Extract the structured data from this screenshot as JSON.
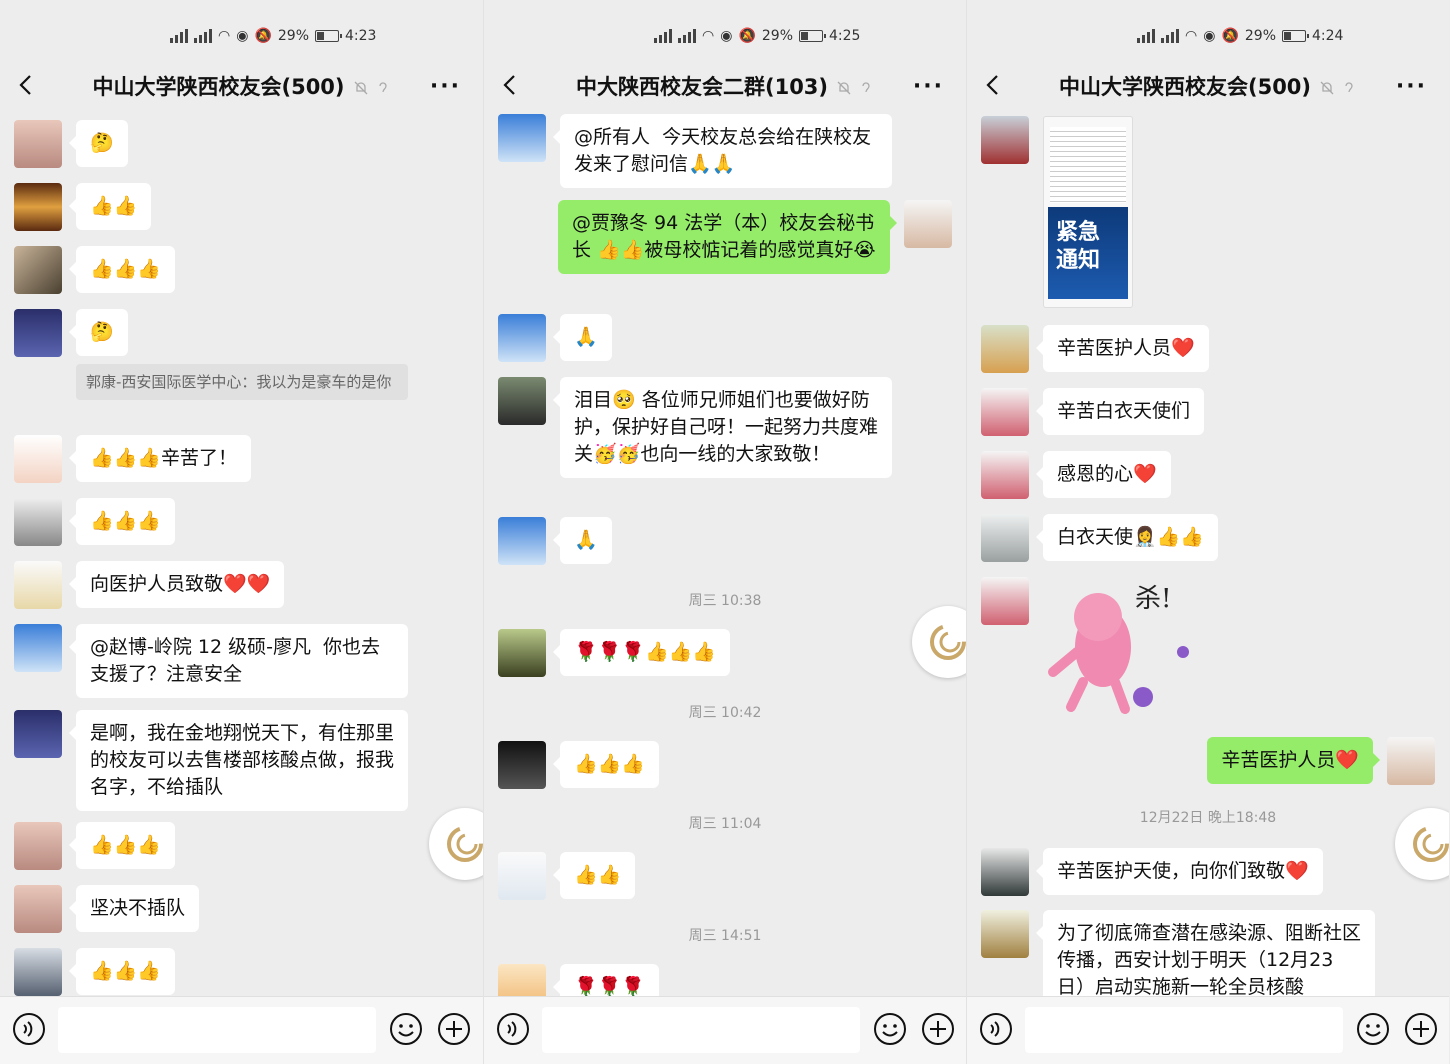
{
  "panels": [
    {
      "status": {
        "battery": "29%",
        "time": "4:23"
      },
      "title": "中山大学陕西校友会(500)",
      "messages": [
        {
          "text": "🤔"
        },
        {
          "text": "👍👍"
        },
        {
          "text": "👍👍👍"
        },
        {
          "text": "🤔"
        },
        {
          "quote": "郭康-西安国际医学中心：我以为是豪车的是你"
        },
        {
          "text": "👍👍👍辛苦了！"
        },
        {
          "text": "👍👍👍"
        },
        {
          "text": "向医护人员致敬❤️❤️"
        },
        {
          "text": "@赵博-岭院 12 级硕-廖凡  你也去支援了？注意安全"
        },
        {
          "text": "是啊，我在金地翔悦天下，有住那里的校友可以去售楼部核酸点做，报我名字，不给插队"
        },
        {
          "text": "👍👍👍"
        },
        {
          "text": "坚决不插队"
        },
        {
          "text": "👍👍👍"
        }
      ]
    },
    {
      "status": {
        "battery": "29%",
        "time": "4:25"
      },
      "title": "中大陕西校友会二群(103)",
      "messages": [
        {
          "text": "@所有人  今天校友总会给在陕校友发来了慰问信🙏🙏"
        },
        {
          "text": "@贾豫冬 94 法学（本）校友会秘书长 👍👍被母校惦记着的感觉真好😭"
        },
        {
          "text": "🙏"
        },
        {
          "text": "泪目🥺 各位师兄师姐们也要做好防护，保护好自己呀！一起努力共度难关🥳🥳也向一线的大家致敬！"
        },
        {
          "text": "🙏"
        },
        {
          "time": "周三 10:38"
        },
        {
          "text": "🌹🌹🌹👍👍👍"
        },
        {
          "time": "周三 10:42"
        },
        {
          "text": "👍👍👍"
        },
        {
          "time": "周三 11:04"
        },
        {
          "text": "👍👍"
        },
        {
          "time": "周三 14:51"
        },
        {
          "text": "🌹🌹🌹"
        }
      ]
    },
    {
      "status": {
        "battery": "29%",
        "time": "4:24"
      },
      "title": "中山大学陕西校友会(500)",
      "messages": [
        {
          "image_text": "紧急\n通知"
        },
        {
          "text": "辛苦医护人员❤️"
        },
        {
          "text": "辛苦白衣天使们"
        },
        {
          "text": "感恩的心❤️"
        },
        {
          "text": "白衣天使👩‍⚕️👍👍"
        },
        {
          "sticker_text": "杀!"
        },
        {
          "text": "辛苦医护人员❤️"
        },
        {
          "time": "12月22日 晚上18:48"
        },
        {
          "text": "辛苦医护天使，向你们致敬❤️"
        },
        {
          "text": "为了彻底筛查潜在感染源、阻断社区传播，西安计划于明天（12月23日）启动实施新一轮全员核酸"
        }
      ]
    }
  ],
  "colors": {
    "chat_bg": "#ededed",
    "self_bubble": "#95ec69",
    "other_bubble": "#ffffff"
  }
}
